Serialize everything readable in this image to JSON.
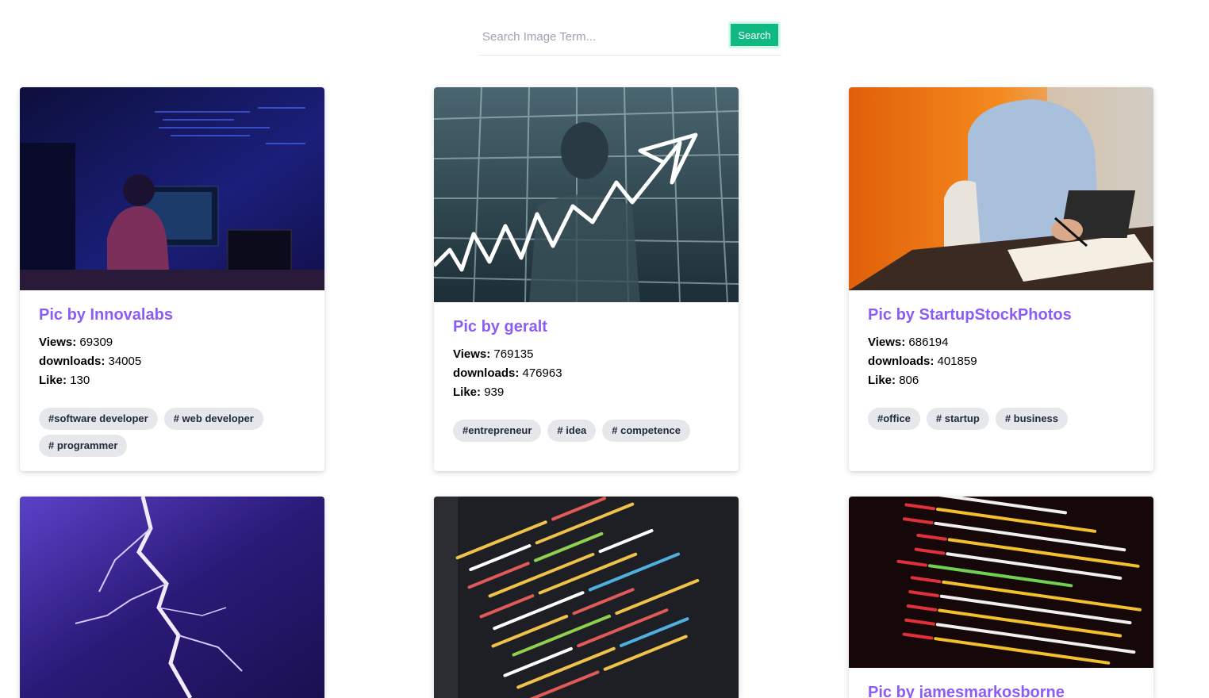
{
  "search": {
    "placeholder": "Search Image Term...",
    "button_label": "Search"
  },
  "labels": {
    "views": "Views:",
    "downloads": "downloads:",
    "likes": "Like:"
  },
  "cards": [
    {
      "title": "Pic by Innovalabs",
      "views": "69309",
      "downloads": "34005",
      "likes": "130",
      "tags": [
        "#software developer",
        "# web developer",
        "# programmer"
      ]
    },
    {
      "title": "Pic by geralt",
      "views": "769135",
      "downloads": "476963",
      "likes": "939",
      "tags": [
        "#entrepreneur",
        "# idea",
        "# competence"
      ]
    },
    {
      "title": "Pic by StartupStockPhotos",
      "views": "686194",
      "downloads": "401859",
      "likes": "806",
      "tags": [
        "#office",
        "# startup",
        "# business"
      ]
    },
    {
      "title": "",
      "views": "",
      "downloads": "",
      "likes": "",
      "tags": []
    },
    {
      "title": "",
      "views": "",
      "downloads": "",
      "likes": "",
      "tags": []
    },
    {
      "title": "Pic by jamesmarkosborne",
      "views": "",
      "downloads": "",
      "likes": "",
      "tags": []
    }
  ],
  "colors": {
    "accent": "#8b5cf6",
    "button": "#10b981",
    "tag_bg": "#e5e7eb"
  }
}
